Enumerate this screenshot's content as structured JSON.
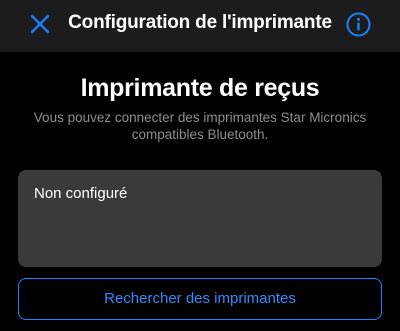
{
  "nav": {
    "title": "Configuration de l'imprimante",
    "close_icon": "close-x-icon",
    "info_icon": "info-circle-icon"
  },
  "main": {
    "heading": "Imprimante de reçus",
    "subtitle_line1": "Vous pouvez connecter des imprimantes Star Micronics",
    "subtitle_line2": "compatibles Bluetooth.",
    "status": "Non configuré",
    "search_button_label": "Rechercher des imprimantes"
  },
  "colors": {
    "accent": "#1a82fb",
    "background": "#000000",
    "nav_background": "#1c1c1e",
    "card_background": "#3a3a3c",
    "secondary_text": "#8e8e93"
  }
}
